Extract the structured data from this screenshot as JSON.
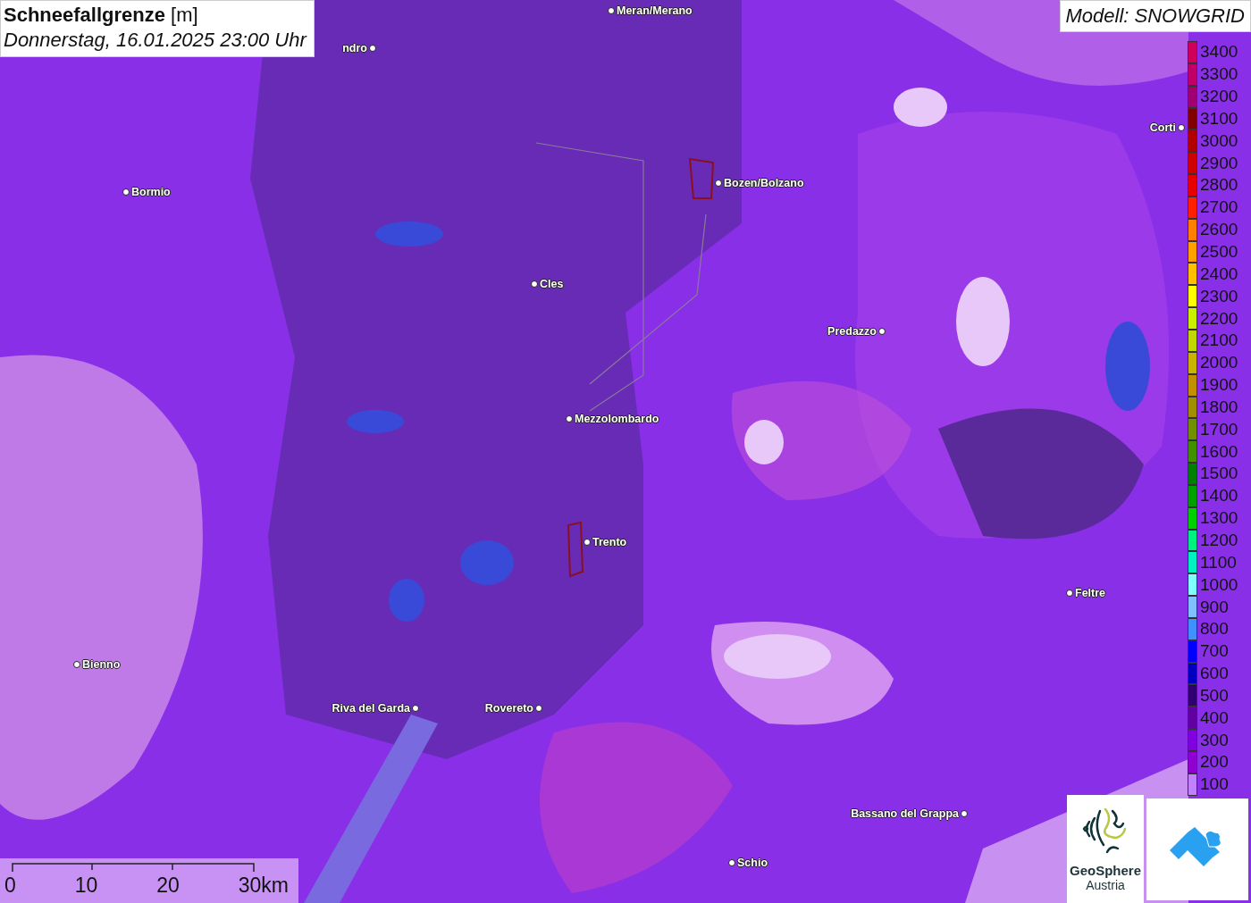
{
  "title": {
    "parameter": "Schneefallgrenze",
    "unit": "[m]",
    "datetime": "Donnerstag, 16.01.2025 23:00 Uhr"
  },
  "model": "Modell: SNOWGRID",
  "cities": [
    {
      "name": "ndro"
    },
    {
      "name": "Meran/Merano"
    },
    {
      "name": "Bormio"
    },
    {
      "name": "Bozen/Bolzano"
    },
    {
      "name": "Cles"
    },
    {
      "name": "Predazzo"
    },
    {
      "name": "Mezzolombardo"
    },
    {
      "name": "Trento"
    },
    {
      "name": "Feltre"
    },
    {
      "name": "Bienno"
    },
    {
      "name": "Riva del Garda"
    },
    {
      "name": "Rovereto"
    },
    {
      "name": "Bassano del Grappa"
    },
    {
      "name": "Schio"
    },
    {
      "name": "Corti"
    }
  ],
  "legend": [
    {
      "label": "3400",
      "color": "#d0005a"
    },
    {
      "label": "3300",
      "color": "#c00068"
    },
    {
      "label": "3200",
      "color": "#a00070"
    },
    {
      "label": "3100",
      "color": "#800000"
    },
    {
      "label": "3000",
      "color": "#b00000"
    },
    {
      "label": "2900",
      "color": "#d00000"
    },
    {
      "label": "2800",
      "color": "#e80000"
    },
    {
      "label": "2700",
      "color": "#ff2000"
    },
    {
      "label": "2600",
      "color": "#ff8000"
    },
    {
      "label": "2500",
      "color": "#ffa000"
    },
    {
      "label": "2400",
      "color": "#ffc000"
    },
    {
      "label": "2300",
      "color": "#ffff00"
    },
    {
      "label": "2200",
      "color": "#c8f000"
    },
    {
      "label": "2100",
      "color": "#c0d800"
    },
    {
      "label": "2000",
      "color": "#c8b400"
    },
    {
      "label": "1900",
      "color": "#c09000"
    },
    {
      "label": "1800",
      "color": "#a09000"
    },
    {
      "label": "1700",
      "color": "#709000"
    },
    {
      "label": "1600",
      "color": "#409000"
    },
    {
      "label": "1500",
      "color": "#008000"
    },
    {
      "label": "1400",
      "color": "#00a000"
    },
    {
      "label": "1300",
      "color": "#00d000"
    },
    {
      "label": "1200",
      "color": "#00f080"
    },
    {
      "label": "1100",
      "color": "#00f0c0"
    },
    {
      "label": "1000",
      "color": "#80ffff"
    },
    {
      "label": "900",
      "color": "#80c0ff"
    },
    {
      "label": "800",
      "color": "#4090ff"
    },
    {
      "label": "700",
      "color": "#0000ff"
    },
    {
      "label": "600",
      "color": "#0000c0"
    },
    {
      "label": "500",
      "color": "#300070"
    },
    {
      "label": "400",
      "color": "#6000a0"
    },
    {
      "label": "300",
      "color": "#8000e0"
    },
    {
      "label": "200",
      "color": "#9000d0"
    },
    {
      "label": "100",
      "color": "#c080ff"
    }
  ],
  "scale_bar": [
    "0",
    "10",
    "20",
    "30km"
  ],
  "logos": {
    "geosphere": [
      "GeoSphere",
      "Austria"
    ]
  }
}
